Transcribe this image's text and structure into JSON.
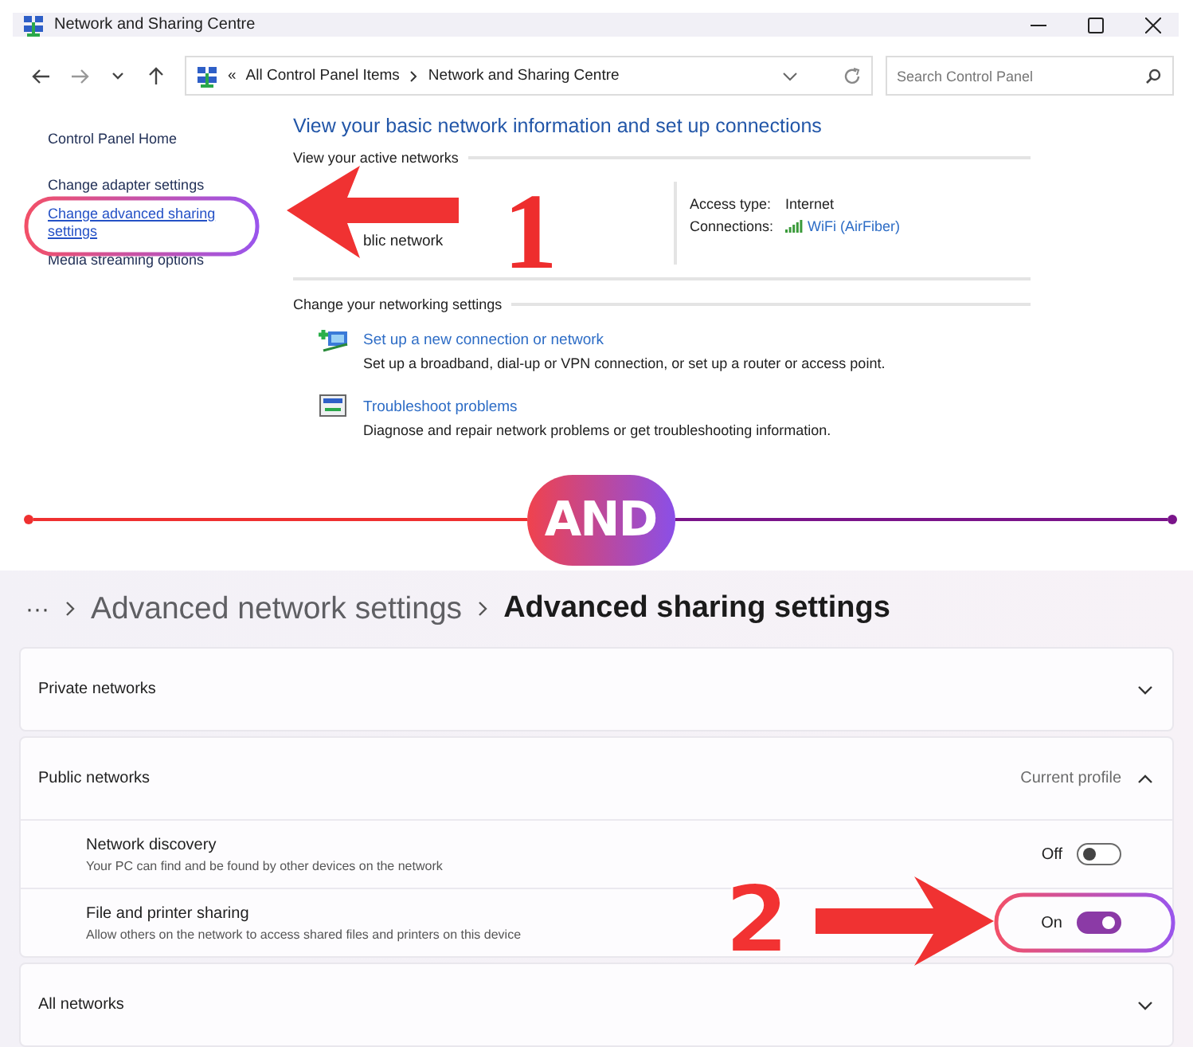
{
  "control_panel": {
    "title": "Network and Sharing Centre",
    "address": {
      "prefix": "«",
      "items": [
        "All Control Panel Items",
        "Network and Sharing Centre"
      ]
    },
    "search": {
      "placeholder": "Search Control Panel"
    },
    "sidebar": {
      "items": [
        {
          "label": "Control Panel Home",
          "kind": "home",
          "highlighted": false
        },
        {
          "label": "Change adapter settings",
          "kind": "link",
          "highlighted": false
        },
        {
          "label": "Change advanced sharing settings",
          "kind": "link",
          "highlighted": true
        },
        {
          "label": "Media streaming options",
          "kind": "link",
          "highlighted": false
        }
      ]
    },
    "heading": "View your basic network information and set up connections",
    "active_networks": {
      "heading": "View your active networks",
      "network_name": "blic network",
      "access_type_label": "Access type:",
      "access_type": "Internet",
      "connections_label": "Connections:",
      "connection": "WiFi (AirFiber)"
    },
    "networking_settings": {
      "heading": "Change your networking settings",
      "tasks": [
        {
          "kind": "new-connection",
          "title": "Set up a new connection or network",
          "description": "Set up a broadband, dial-up or VPN connection, or set up a router or access point."
        },
        {
          "kind": "troubleshoot",
          "title": "Troubleshoot problems",
          "description": "Diagnose and repair network problems or get troubleshooting information."
        }
      ]
    }
  },
  "divider": {
    "label": "AND"
  },
  "settings_page": {
    "breadcrumb": [
      {
        "label": "···",
        "current": false
      },
      {
        "label": "Advanced network settings",
        "current": false
      },
      {
        "label": "Advanced sharing settings",
        "current": true
      }
    ],
    "sections": [
      {
        "title": "Private networks",
        "expanded": false
      },
      {
        "title": "Public networks",
        "note": "Current profile",
        "expanded": true,
        "settings": [
          {
            "title": "Network discovery",
            "description": "Your PC can find and be found by other devices on the network",
            "state_label": "Off",
            "on": false,
            "highlighted": false
          },
          {
            "title": "File and printer sharing",
            "description": "Allow others on the network to access shared files and printers on this device",
            "state_label": "On",
            "on": true,
            "highlighted": true
          }
        ]
      },
      {
        "title": "All networks",
        "expanded": false
      }
    ]
  },
  "annotations": [
    {
      "number": "1"
    },
    {
      "number": "2"
    }
  ]
}
